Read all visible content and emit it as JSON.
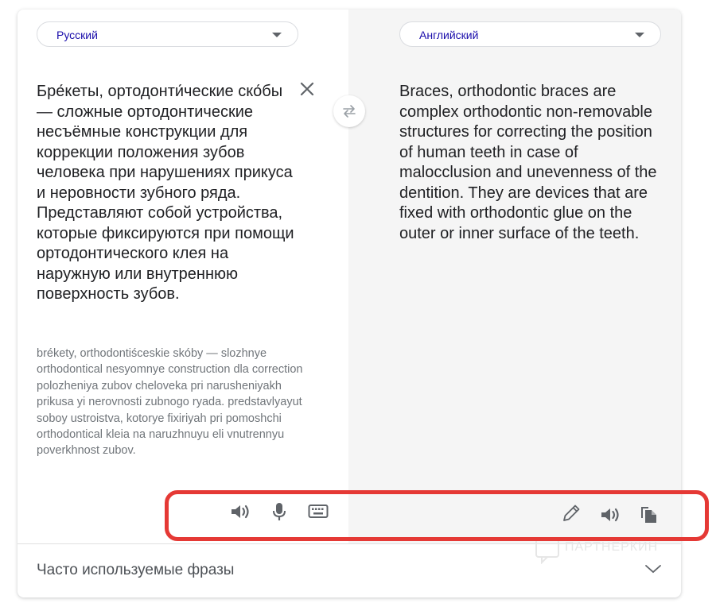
{
  "source_lang": {
    "label": "Русский"
  },
  "target_lang": {
    "label": "Английский"
  },
  "source_text": "Бре́кеты, ортодонти́ческие ско́бы — сложные ортодонтические несъёмные конструкции для коррекции положения зубов человека при нарушениях прикуса и неровности зубного ряда. Представляют собой устройства, которые фиксируются при помощи ортодонтического клея на наружную или внутреннюю поверхность зубов.",
  "transliteration": "brékety, orthodontiśceskie skóby — slozhnye orthodontical nesyomnye construction dla correction polozheniya zubov cheloveka pri narusheniyakh prikusa yi nerovnosti zubnogo ryada. predstavlyayut soboy ustroistva, kotorye fixiriyah pri pomoshchi orthodontical kleia na naruzhnuyu eli vnutrennyu poverkhnost zubov.",
  "target_text": "Braces, orthodontic braces are complex orthodontic non-removable structures for correcting the position of human teeth in case of malocclusion and unevenness of the dentition. They are devices that are fixed with orthodontic glue on the outer or inner surface of the teeth.",
  "phrases": {
    "label": "Часто используемые фразы"
  },
  "watermark": "ПАРТНЕРКИН",
  "colors": {
    "highlight": "#e53935",
    "link": "#1a0dab",
    "icon": "#5f6368"
  },
  "icons": {
    "clear": "close-icon",
    "swap": "swap-icon",
    "source_tools": [
      "speaker-icon",
      "microphone-icon",
      "keyboard-icon"
    ],
    "target_tools": [
      "pencil-icon",
      "speaker-icon",
      "copy-icon"
    ],
    "phrases": "chevron-down-icon"
  }
}
